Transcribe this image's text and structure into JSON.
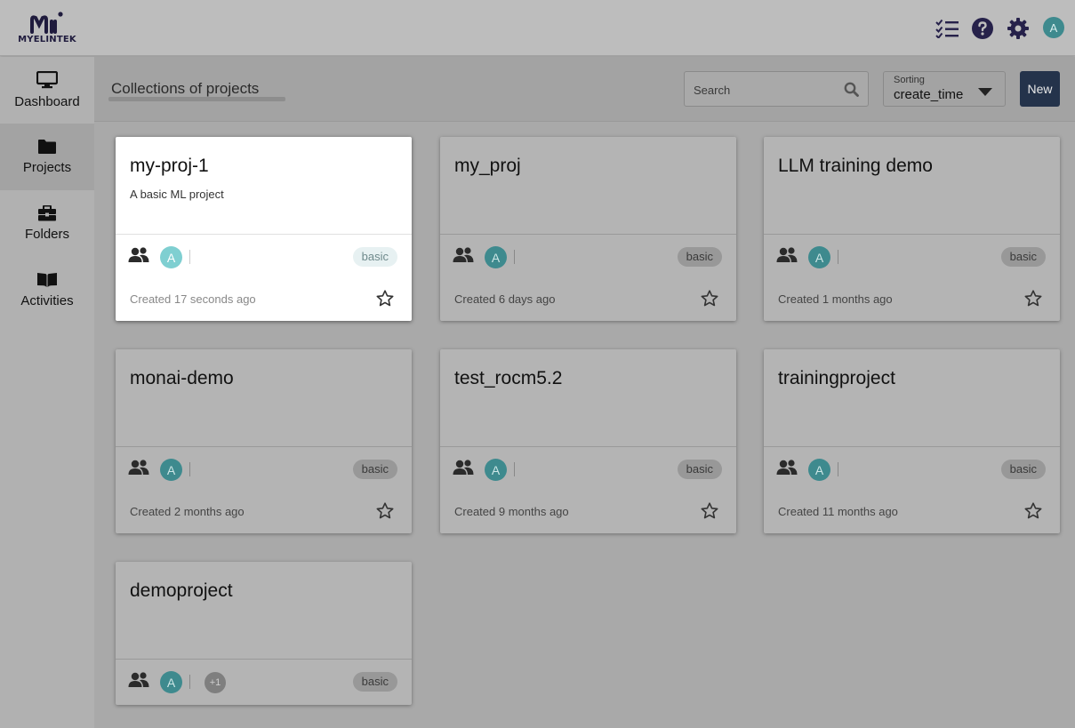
{
  "app": {
    "logo_text": "MYELINTEK",
    "icons": [
      "tasks-icon",
      "help-icon",
      "settings-icon"
    ],
    "user_initial": "A",
    "accent_color": "#3e8a8e",
    "brand_color": "#24334b"
  },
  "sidebar": {
    "items": [
      {
        "label": "Dashboard",
        "icon": "monitor-icon",
        "active": false
      },
      {
        "label": "Projects",
        "icon": "folder-icon",
        "active": true
      },
      {
        "label": "Folders",
        "icon": "toolbox-icon",
        "active": false
      },
      {
        "label": "Activities",
        "icon": "book-icon",
        "active": false
      }
    ]
  },
  "toolbar": {
    "title": "Collections of projects",
    "search_placeholder": "Search",
    "sort_label": "Sorting",
    "sort_value": "create_time",
    "new_label": "New"
  },
  "projects": [
    {
      "title": "my-proj-1",
      "description": "A basic ML project",
      "member_initial": "A",
      "extra": "",
      "badge": "basic",
      "created": "Created 17 seconds ago",
      "highlight": true
    },
    {
      "title": "my_proj",
      "description": "",
      "member_initial": "A",
      "extra": "",
      "badge": "basic",
      "created": "Created 6 days ago",
      "highlight": false
    },
    {
      "title": "LLM training demo",
      "description": "",
      "member_initial": "A",
      "extra": "",
      "badge": "basic",
      "created": "Created 1 months ago",
      "highlight": false
    },
    {
      "title": "monai-demo",
      "description": "",
      "member_initial": "A",
      "extra": "",
      "badge": "basic",
      "created": "Created 2 months ago",
      "highlight": false
    },
    {
      "title": "test_rocm5.2",
      "description": "",
      "member_initial": "A",
      "extra": "",
      "badge": "basic",
      "created": "Created 9 months ago",
      "highlight": false
    },
    {
      "title": "trainingproject",
      "description": "",
      "member_initial": "A",
      "extra": "",
      "badge": "basic",
      "created": "Created 11 months ago",
      "highlight": false
    },
    {
      "title": "demoproject",
      "description": "",
      "member_initial": "A",
      "extra": "+1",
      "badge": "basic",
      "created": "",
      "highlight": false
    }
  ]
}
